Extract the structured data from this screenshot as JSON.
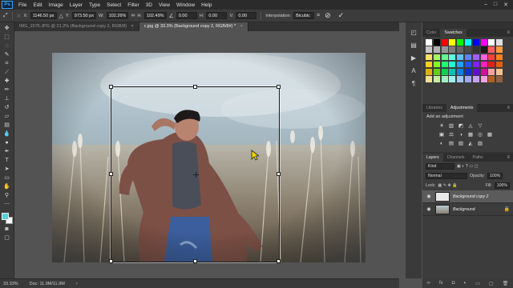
{
  "app": {
    "logo": "Ps"
  },
  "menu": [
    "File",
    "Edit",
    "Image",
    "Layer",
    "Type",
    "Select",
    "Filter",
    "3D",
    "View",
    "Window",
    "Help"
  ],
  "window_controls": [
    "–",
    "□",
    "✕"
  ],
  "options": {
    "x_label": "X:",
    "x_value": "1146.50 px",
    "y_label": "Y:",
    "y_value": "973.50 px",
    "w_label": "W:",
    "w_value": "102.26%",
    "h_label": "H:",
    "h_value": "102.49%",
    "angle_value": "0.00",
    "hskew_label": "H:",
    "hskew_value": "0.00",
    "vskew_label": "V:",
    "vskew_value": "0.00",
    "interpolation_label": "Interpolation:",
    "interpolation_value": "Bicubic"
  },
  "tabs": [
    {
      "label": "IMG_1575.JPG @ 21.2% (Background copy 2, RGB/8)",
      "close": "×"
    },
    {
      "label": "c.jpg @ 33.3% (Background copy 2, RGB/8#) *",
      "close": "×"
    }
  ],
  "status": {
    "zoom": "33.33%",
    "doc": "Doc: 11.9M/11.9M",
    "arrow": "›"
  },
  "swatches_panel": {
    "tabs": [
      "Color",
      "Swatches"
    ],
    "colors": [
      "#ffffff",
      "#000000",
      "#ff0000",
      "#ffff00",
      "#00ff00",
      "#00ffff",
      "#0000ff",
      "#ff00ff",
      "#ffffff",
      "#e0e0e0",
      "#c8c8c8",
      "#b0b0b0",
      "#969696",
      "#7d7d7d",
      "#646464",
      "#4b4b4b",
      "#323232",
      "#191919",
      "#ff6060",
      "#ff9a40",
      "#ffe060",
      "#a0ff60",
      "#60ff90",
      "#60ffe0",
      "#60c0ff",
      "#6080ff",
      "#a060ff",
      "#ff60e0",
      "#ff4040",
      "#ff8020",
      "#ffd020",
      "#80ff20",
      "#20ff70",
      "#20ffd0",
      "#20a0ff",
      "#2050ff",
      "#8020ff",
      "#ff20c0",
      "#e02020",
      "#e06010",
      "#e0b010",
      "#60d010",
      "#10d050",
      "#10c0b0",
      "#1080e0",
      "#1030d0",
      "#6010d0",
      "#d010a0",
      "#f4a0a0",
      "#f4c090",
      "#f4e090",
      "#c0f0a0",
      "#a0f0c0",
      "#a0f0f0",
      "#a0c8f4",
      "#a0a8f4",
      "#c8a0f4",
      "#f4a0e0",
      "#b06020",
      "#906040"
    ]
  },
  "adjustments_panel": {
    "tabs": [
      "Libraries",
      "Adjustments"
    ],
    "title": "Add an adjustment",
    "rows": [
      [
        "☀",
        "▥",
        "◩",
        "◬",
        "▽"
      ],
      [
        "▣",
        "⚖",
        "◑",
        "▦",
        "◎",
        "▩"
      ],
      [
        "◐",
        "▤",
        "▧",
        "◭",
        "▨"
      ]
    ]
  },
  "layers_panel": {
    "tabs": [
      "Layers",
      "Channels",
      "Paths"
    ],
    "kind_label": "Kind",
    "blend_mode": "Normal",
    "opacity_label": "Opacity:",
    "opacity_value": "100%",
    "lock_label": "Lock:",
    "fill_label": "Fill:",
    "fill_value": "100%",
    "layers": [
      {
        "name": "Background copy 2",
        "selected": true
      },
      {
        "name": "Background",
        "selected": false
      }
    ],
    "footer_icons": [
      "∞",
      "fx",
      "◘",
      "◐",
      "▭",
      "▢",
      "🗑"
    ]
  }
}
